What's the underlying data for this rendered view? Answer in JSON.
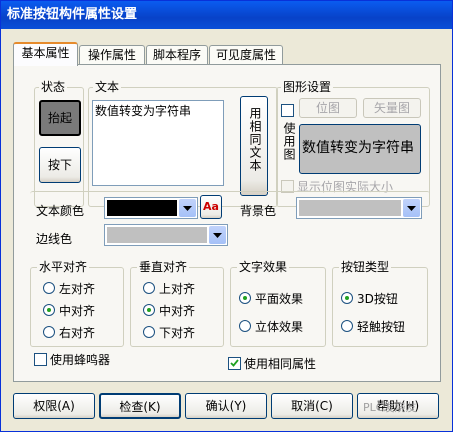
{
  "window": {
    "title": "标准按钮构件属性设置"
  },
  "tabs": [
    {
      "label": "基本属性",
      "active": true
    },
    {
      "label": "操作属性",
      "active": false
    },
    {
      "label": "脚本程序",
      "active": false
    },
    {
      "label": "可见度属性",
      "active": false
    }
  ],
  "state_group": {
    "title": "状态",
    "lift_label": "抬起",
    "press_label": "按下"
  },
  "text_group": {
    "title": "文本",
    "value": "数值转变为字符串",
    "same_text_label": "用相同文本"
  },
  "graphic_group": {
    "title": "图形设置",
    "use_graphic_label": "使用图",
    "bitmap_label": "位图",
    "vector_label": "矢量图",
    "preview_text": "数值转变为字符串",
    "show_actual_size_label": "显示位图实际大小"
  },
  "colors_row": {
    "text_color_label": "文本颜色",
    "text_color": "#000000",
    "font_button_label": "Aa",
    "bg_color_label": "背景色",
    "bg_color": "#c0c0c0",
    "border_color_label": "边线色",
    "border_color": "#c0c0c0"
  },
  "h_align": {
    "title": "水平对齐",
    "options": [
      "左对齐",
      "中对齐",
      "右对齐"
    ],
    "selected": 1
  },
  "v_align": {
    "title": "垂直对齐",
    "options": [
      "上对齐",
      "中对齐",
      "下对齐"
    ],
    "selected": 1
  },
  "text_effect": {
    "title": "文字效果",
    "options": [
      "平面效果",
      "立体效果"
    ],
    "selected": 0
  },
  "button_type": {
    "title": "按钮类型",
    "options": [
      "3D按钮",
      "轻触按钮"
    ],
    "selected": 0
  },
  "checkboxes": {
    "buzzer_label": "使用蜂鸣器",
    "buzzer": false,
    "same_attr_label": "使用相同属性",
    "same_attr": true
  },
  "footer": {
    "permission_label": "权限(A)",
    "check_label": "检查(K)",
    "ok_label": "确认(Y)",
    "cancel_label": "取消(C)",
    "help_label": "帮助(H)"
  },
  "watermark": "PLC发烧友"
}
